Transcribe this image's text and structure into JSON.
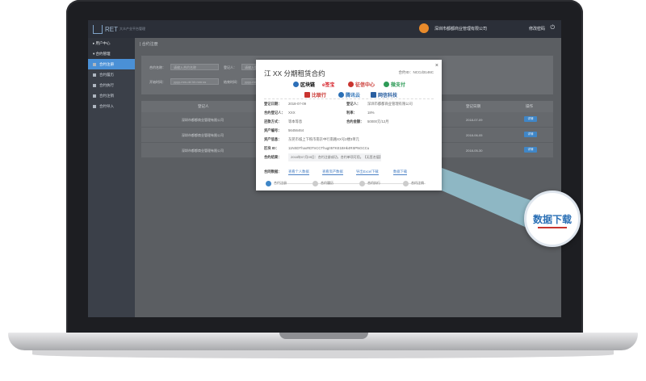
{
  "app": {
    "logo": "RET",
    "logo_sub": "大众产业平台管理",
    "company": "深圳市都都商业管理有限公司",
    "change_password": "修改密码",
    "exit_icon": "exit-icon"
  },
  "sidebar": {
    "items": [
      {
        "label": "用户中心",
        "type": "head"
      },
      {
        "label": "合约管理",
        "type": "head"
      },
      {
        "label": "合约注册",
        "type": "active"
      },
      {
        "label": "合约履历",
        "type": "item"
      },
      {
        "label": "合约执行",
        "type": "item"
      },
      {
        "label": "合约注销",
        "type": "item"
      },
      {
        "label": "合约导入",
        "type": "item"
      }
    ]
  },
  "main": {
    "breadcrumb": "合约注册",
    "filters": {
      "name_label": "合约名称：",
      "name_placeholder": "请输入合约名称",
      "registrant_label": "登记人：",
      "registrant_placeholder": "请输入登记人",
      "start_label": "开始时间：",
      "start_placeholder": "yyyy-mm-dd hh:mm:ss",
      "end_label": "结束时间：",
      "end_placeholder": "yyyy-mm-dd"
    },
    "table": {
      "headers": [
        "登记人",
        "登记日期",
        "操作"
      ],
      "rows": [
        {
          "registrant": "深圳市都都商业管理有限公司",
          "date": "2018-07-09",
          "action": "详情"
        },
        {
          "registrant": "深圳市都都商业管理有限公司",
          "date": "2018-06-05",
          "action": "详情"
        },
        {
          "registrant": "深圳市都都商业管理有限公司",
          "date": "2018-05-30",
          "action": "详情"
        }
      ]
    }
  },
  "modal": {
    "title": "江 XX 分期租赁合约",
    "contract_id": "合约ID：NCCd3146C",
    "close": "×",
    "partners": [
      {
        "name": "区块链",
        "color": "#2c6fb8"
      },
      {
        "name": "e签宝",
        "color": "#d7262e"
      },
      {
        "name": "征信中心",
        "color": "#c9342f"
      },
      {
        "name": "微支付",
        "color": "#2e9b57"
      },
      {
        "name": "比联行",
        "color": "#c9342f"
      },
      {
        "name": "腾讯云",
        "color": "#2a6fb5"
      },
      {
        "name": "网信科技",
        "color": "#2a5fa0"
      }
    ],
    "fields": [
      {
        "label": "登记日期：",
        "value": "2018-07-09"
      },
      {
        "label": "登记人：",
        "value": "深圳市都都商业管理有限公司"
      },
      {
        "label": "合约登记人：",
        "value": "XXX"
      },
      {
        "label": "利率：",
        "value": "18%"
      },
      {
        "label": "还款方式：",
        "value": "等本等息"
      },
      {
        "label": "合约金额：",
        "value": "50000元/12月"
      },
      {
        "label": "资产编号：",
        "value": "56456464"
      },
      {
        "label": "资产信息：",
        "value": "东莞市城上下购市南京中行南路XX号2楼3单元"
      },
      {
        "label": "区块 ID：",
        "value": "11NSDThaxRDTnCCThug05TKE1BHk4RSPNGCCu"
      },
      {
        "label": "合约结果：",
        "value": "2018年07月09日：合约注册成功，合约单项可用。【无签名值】"
      }
    ],
    "links_label": "合同数据：",
    "links": [
      "查看个人数据",
      "查看资产数据",
      "导出Excel下载",
      "数据下载"
    ],
    "timeline": [
      "合约注册",
      "合约履历",
      "合约执行",
      "合约注销"
    ]
  },
  "callout": {
    "label": "数据下载"
  },
  "colors": {
    "accent": "#3f86c7",
    "topbar": "#2b2f38",
    "sidebar": "#3b4049",
    "callout_text": "#2a6fb5",
    "callout_underline": "#c9342f"
  }
}
